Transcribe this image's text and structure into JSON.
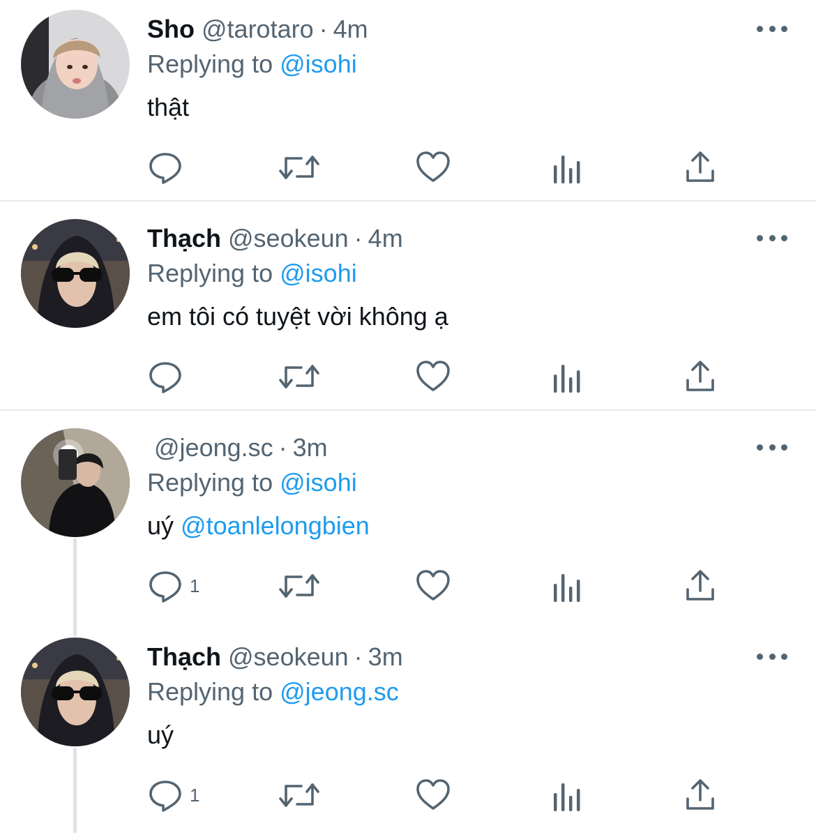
{
  "tweets": [
    {
      "name": "Sho",
      "handle": "@tarotaro",
      "separator": "·",
      "time": "4m",
      "replying_prefix": "Replying to",
      "replying_to": "@isohi",
      "text": "thật",
      "text_mention": "",
      "reply_count": ""
    },
    {
      "name": "Thạch",
      "handle": "@seokeun",
      "separator": "·",
      "time": "4m",
      "replying_prefix": "Replying to",
      "replying_to": "@isohi",
      "text": "em tôi có tuyệt vời không ạ",
      "text_mention": "",
      "reply_count": ""
    },
    {
      "name": "",
      "handle": "@jeong.sc",
      "separator": "·",
      "time": "3m",
      "replying_prefix": "Replying to",
      "replying_to": "@isohi",
      "text": "uý ",
      "text_mention": "@toanlelongbien",
      "reply_count": "1"
    },
    {
      "name": "Thạch",
      "handle": "@seokeun",
      "separator": "·",
      "time": "3m",
      "replying_prefix": "Replying to",
      "replying_to": "@jeong.sc",
      "text": "uý",
      "text_mention": "",
      "reply_count": "1"
    }
  ],
  "icons": {
    "reply": "reply-icon",
    "retweet": "retweet-icon",
    "like": "like-icon",
    "analytics": "analytics-icon",
    "share": "share-icon",
    "more": "more-options-icon"
  },
  "colors": {
    "text_primary": "#0f1419",
    "text_secondary": "#536471",
    "link": "#1d9bf0",
    "divider": "#e6e9eb"
  }
}
